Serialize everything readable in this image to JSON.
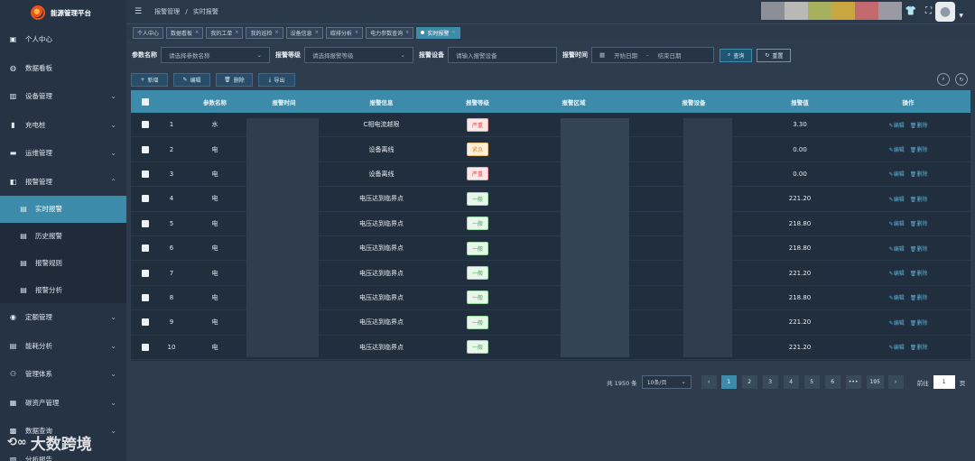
{
  "app": {
    "title": "能源管理平台"
  },
  "sidebar": {
    "items": [
      {
        "label": "个人中心",
        "icon": "user-icon"
      },
      {
        "label": "数据看板",
        "icon": "dashboard-icon"
      },
      {
        "label": "设备管理",
        "icon": "bar-chart-icon",
        "expandable": true
      },
      {
        "label": "充电桩",
        "icon": "charger-icon",
        "expandable": true
      },
      {
        "label": "运维管理",
        "icon": "wrench-icon",
        "expandable": true
      },
      {
        "label": "报警管理",
        "icon": "alarm-icon",
        "expandable": true,
        "expanded": true
      }
    ],
    "alarm_sub": [
      {
        "label": "实时报警",
        "active": true
      },
      {
        "label": "历史报警"
      },
      {
        "label": "报警规则"
      },
      {
        "label": "报警分析"
      }
    ],
    "items_after": [
      {
        "label": "定额管理",
        "icon": "target-icon",
        "expandable": true
      },
      {
        "label": "能耗分析",
        "icon": "analysis-icon",
        "expandable": true
      },
      {
        "label": "管理体系",
        "icon": "org-icon",
        "expandable": true
      },
      {
        "label": "碳资产管理",
        "icon": "asset-icon",
        "expandable": true
      },
      {
        "label": "数据查询",
        "icon": "query-icon",
        "expandable": true
      },
      {
        "label": "分析报告",
        "icon": "report-icon"
      }
    ]
  },
  "header": {
    "breadcrumb_1": "报警管理",
    "breadcrumb_sep": "/",
    "breadcrumb_2": "实时报警"
  },
  "tabs": [
    {
      "label": "个人中心",
      "closable": false
    },
    {
      "label": "数据看板",
      "closable": true
    },
    {
      "label": "我的工单",
      "closable": true
    },
    {
      "label": "我的巡检",
      "closable": true
    },
    {
      "label": "设备信息",
      "closable": true
    },
    {
      "label": "碳排分析",
      "closable": true
    },
    {
      "label": "电力参数查询",
      "closable": true
    },
    {
      "label": "实时报警",
      "closable": true,
      "active": true
    }
  ],
  "filters": {
    "param_label": "参数名称",
    "param_placeholder": "请选择参数名称",
    "level_label": "报警等级",
    "level_placeholder": "请选择报警等级",
    "device_label": "报警设备",
    "device_placeholder": "请输入报警设备",
    "time_label": "报警时间",
    "start_placeholder": "开始日期",
    "range_sep": "-",
    "end_placeholder": "结束日期",
    "query_label": "查询",
    "reset_label": "重置"
  },
  "actions": {
    "add": "新增",
    "edit": "编辑",
    "delete": "删除",
    "export": "导出"
  },
  "table": {
    "columns": [
      "参数名称",
      "报警时间",
      "报警信息",
      "报警等级",
      "报警区域",
      "报警设备",
      "报警值",
      "操作"
    ],
    "rows": [
      {
        "idx": "1",
        "param": "水",
        "info": "C相电流越限",
        "level": "严重",
        "level_type": "severe",
        "value": "3.30"
      },
      {
        "idx": "2",
        "param": "电",
        "info": "设备离线",
        "level": "紧急",
        "level_type": "urgent",
        "value": "0.00"
      },
      {
        "idx": "3",
        "param": "电",
        "info": "设备离线",
        "level": "严重",
        "level_type": "severe",
        "value": "0.00"
      },
      {
        "idx": "4",
        "param": "电",
        "info": "电压达到临界点",
        "level": "一般",
        "level_type": "normal",
        "value": "221.20"
      },
      {
        "idx": "5",
        "param": "电",
        "info": "电压达到临界点",
        "level": "一般",
        "level_type": "normal",
        "value": "218.80"
      },
      {
        "idx": "6",
        "param": "电",
        "info": "电压达到临界点",
        "level": "一般",
        "level_type": "normal",
        "value": "218.80"
      },
      {
        "idx": "7",
        "param": "电",
        "info": "电压达到临界点",
        "level": "一般",
        "level_type": "normal",
        "value": "221.20"
      },
      {
        "idx": "8",
        "param": "电",
        "info": "电压达到临界点",
        "level": "一般",
        "level_type": "normal",
        "value": "218.80"
      },
      {
        "idx": "9",
        "param": "电",
        "info": "电压达到临界点",
        "level": "一般",
        "level_type": "normal",
        "value": "221.20"
      },
      {
        "idx": "10",
        "param": "电",
        "info": "电压达到临界点",
        "level": "一般",
        "level_type": "normal",
        "value": "221.20"
      }
    ],
    "op_edit": "编辑",
    "op_delete": "删除"
  },
  "pagination": {
    "total": "共 1950 条",
    "page_size": "10条/页",
    "pages": [
      "1",
      "2",
      "3",
      "4",
      "5",
      "6",
      "•••",
      "195"
    ],
    "current": "1",
    "goto_label": "前往",
    "goto_value": "1",
    "goto_suffix": "页"
  },
  "watermark": {
    "logo": "!D0",
    "text": "大数跨境"
  },
  "colors": {
    "accent": "#3c8bab",
    "sidebar": "#253344",
    "severe": "#e24444",
    "urgent": "#e2902a",
    "normal": "#3aaa53"
  }
}
